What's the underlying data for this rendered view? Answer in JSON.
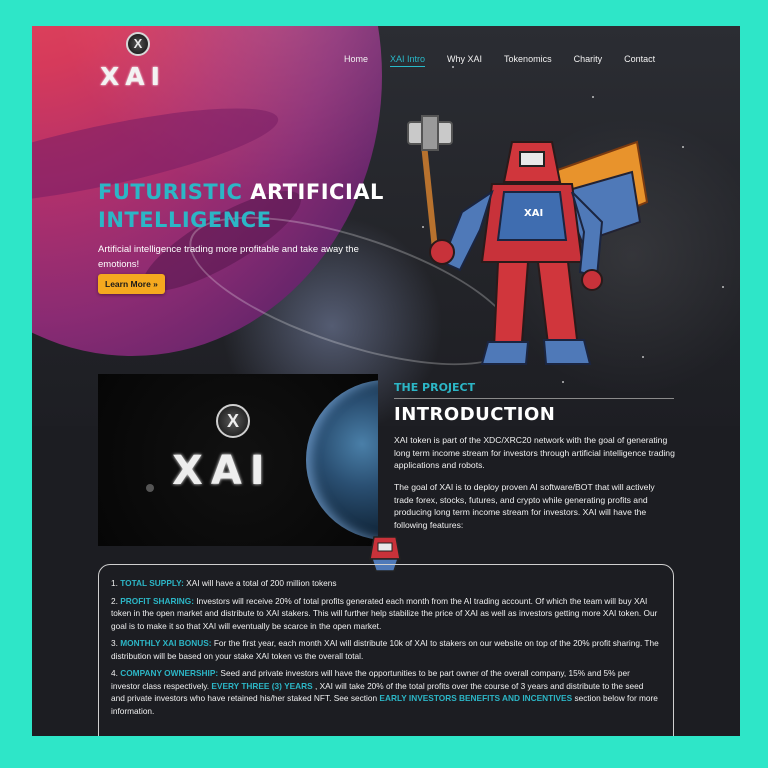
{
  "brand": {
    "name": "XAI",
    "badge": "X"
  },
  "nav": {
    "items": [
      {
        "label": "Home",
        "active": false
      },
      {
        "label": "XAI Intro",
        "active": true
      },
      {
        "label": "Why XAI",
        "active": false
      },
      {
        "label": "Tokenomics",
        "active": false
      },
      {
        "label": "Charity",
        "active": false
      },
      {
        "label": "Contact",
        "active": false
      }
    ]
  },
  "hero": {
    "title_part1": "FUTURISTIC ",
    "title_part2": "ARTIFICIAL",
    "title_part3": "INTELLIGENCE",
    "subtitle": "Artificial intelligence trading more profitable and take away the emotions!",
    "cta_label": "Learn More »"
  },
  "intro": {
    "image_logo": "XAI",
    "image_badge": "X",
    "kicker": "THE PROJECT",
    "title": "INTRODUCTION",
    "paragraph1": "XAI token is part of the XDC/XRC20 network with the goal of generating long term income stream for investors through artificial intelligence trading applications and robots.",
    "paragraph2": "The goal of XAI is to deploy proven AI software/BOT that will actively trade forex, stocks, futures, and crypto while generating profits and producing long term income stream for investors. XAI will have the following features:"
  },
  "features": [
    {
      "num": "1.",
      "label": "TOTAL SUPPLY:",
      "text": " XAI will have a total of 200 million tokens"
    },
    {
      "num": "2.",
      "label": "PROFIT SHARING:",
      "text": " Investors will receive 20% of total profits generated each month from the AI trading account. Of which the team will buy XAI token in the open market and distribute to XAI stakers. This will further help stabilize the price of XAI as well as investors getting more XAI token. Our goal is to make it so that XAI will eventually be scarce in the open market."
    },
    {
      "num": "3.",
      "label": "MONTHLY XAI BONUS:",
      "text": " For the first year, each month XAI will distribute 10k of XAI to stakers on our website on top of the 20% profit sharing. The distribution will be based on your stake XAI token vs the overall total."
    },
    {
      "num": "4.",
      "label": "COMPANY OWNERSHIP:",
      "text": " Seed and private investors will have the opportunities to be part owner of the overall company, 15% and 5% per investor class respectively. ",
      "label2": "EVERY THREE (3) YEARS",
      "text2": " , XAI will take 20% of the total profits over the course of 3 years and distribute to the seed and private investors who have retained his/her staked NFT. See section ",
      "label3": "EARLY INVESTORS BENEFITS AND INCENTIVES",
      "text3": " section below for more information."
    }
  ],
  "colors": {
    "accent": "#2cb6c6",
    "button": "#f5a91f",
    "frame": "#2ee6c8",
    "background": "#1c1d22"
  }
}
